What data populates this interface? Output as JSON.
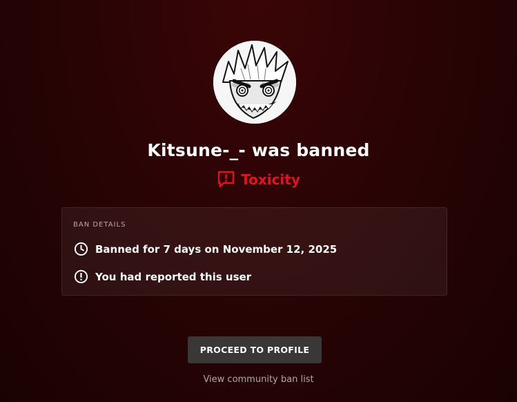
{
  "profile": {
    "avatar_icon": "anime-character-avatar",
    "title": "Kitsune-_- was banned"
  },
  "reason": {
    "icon": "report-flag-icon",
    "label": "Toxicity",
    "color": "#e0141f"
  },
  "details": {
    "heading": "BAN DETAILS",
    "rows": [
      {
        "icon": "clock-icon",
        "text": "Banned for 7 days on November 12, 2025"
      },
      {
        "icon": "alert-circle-icon",
        "text": "You had reported this user"
      }
    ]
  },
  "actions": {
    "proceed_label": "PROCEED TO PROFILE",
    "ban_list_label": "View community ban list"
  },
  "colors": {
    "background": "#240405",
    "button": "#3a3737",
    "accent": "#e0141f"
  }
}
